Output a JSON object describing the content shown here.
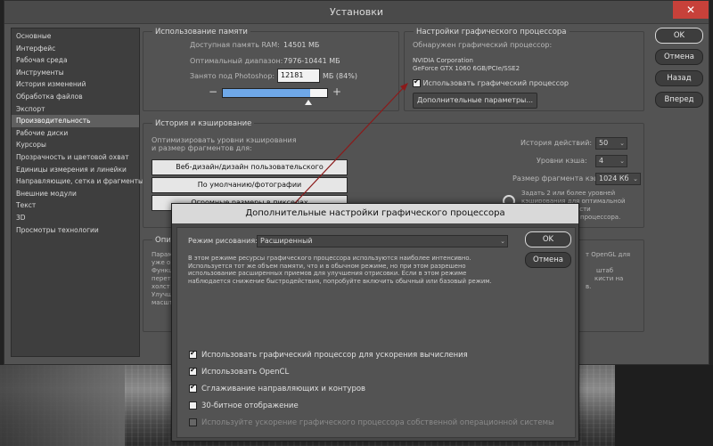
{
  "window": {
    "title": "Установки",
    "close_icon": "✕"
  },
  "sidebar": {
    "items": [
      {
        "label": "Основные"
      },
      {
        "label": "Интерфейс"
      },
      {
        "label": "Рабочая среда"
      },
      {
        "label": "Инструменты"
      },
      {
        "label": "История изменений"
      },
      {
        "label": "Обработка файлов"
      },
      {
        "label": "Экспорт"
      },
      {
        "label": "Производительность",
        "active": true
      },
      {
        "label": "Рабочие диски"
      },
      {
        "label": "Курсоры"
      },
      {
        "label": "Прозрачность и цветовой охват"
      },
      {
        "label": "Единицы измерения и линейки"
      },
      {
        "label": "Направляющие, сетка и фрагменты"
      },
      {
        "label": "Внешние модули"
      },
      {
        "label": "Текст"
      },
      {
        "label": "3D"
      },
      {
        "label": "Просмотры технологии"
      }
    ]
  },
  "memory": {
    "title": "Использование памяти",
    "available_label": "Доступная память RAM:",
    "available_value": "14501 МБ",
    "optimal_label": "Оптимальный диапазон:",
    "optimal_value": "7976-10441 МБ",
    "used_label": "Занято под Photoshop:",
    "used_value": "12181",
    "used_unit": "МБ (84%)",
    "used_fraction": 0.84,
    "minus": "−",
    "plus": "+"
  },
  "gpu": {
    "title": "Настройки графического процессора",
    "detected_label": "Обнаружен графический процессор:",
    "vendor": "NVIDIA Corporation",
    "model": "GeForce GTX 1060 6GB/PCIe/SSE2",
    "use_gpu_label": "Использовать графический процессор",
    "use_gpu_checked": true,
    "advanced_button": "Дополнительные параметры..."
  },
  "buttons": {
    "ok": "OK",
    "cancel": "Отмена",
    "back": "Назад",
    "forward": "Вперед"
  },
  "history_cache": {
    "title": "История и кэширование",
    "optimize_label_1": "Оптимизировать уровни кэширования",
    "optimize_label_2": "и размер фрагментов для:",
    "btn_web": "Веб-дизайн/дизайн пользовательского интерфейса",
    "btn_default": "По умолчанию/фотографии",
    "btn_huge": "Огромные размеры в пикселах",
    "history_states_label": "История действий:",
    "history_states_value": "50",
    "cache_levels_label": "Уровни кэша:",
    "cache_levels_value": "4",
    "tile_size_label": "Размер фрагмента кэша:",
    "tile_size_value": "1024 Кб",
    "hint_1": "Задать 2 или более уровней",
    "hint_2": "кэширования для оптимальной",
    "hint_3": "производительности",
    "hint_4": "процессора."
  },
  "options_group": {
    "title": "Опи",
    "left_fragments": [
      "Парам",
      "уже о",
      "Функц",
      "перета",
      "холст",
      "Улучш",
      "масшт"
    ],
    "right_fragments": [
      "т OpenGL для",
      "",
      "штаб",
      "кисти на",
      "в."
    ]
  },
  "dialog": {
    "title": "Дополнительные настройки графического процессора",
    "mode_label": "Режим рисования:",
    "mode_value": "Расширенный",
    "ok": "OK",
    "cancel": "Отмена",
    "description": [
      "В этом режиме ресурсы графического процессора используются наиболее интенсивно.",
      "Используется тот же объем памяти, что и в обычном режиме, но при этом разрешено",
      "использование расширенных приемов для улучшения отрисовки.  Если в этом режиме",
      "наблюдается снижение быстродействия, попробуйте включить обычный или базовый режим."
    ],
    "options": [
      {
        "label": "Использовать графический процессор для ускорения вычисления",
        "checked": true,
        "disabled": false
      },
      {
        "label": "Использовать OpenCL",
        "checked": true,
        "disabled": false
      },
      {
        "label": "Сглаживание направляющих и контуров",
        "checked": true,
        "disabled": false
      },
      {
        "label": "30-битное отображение",
        "checked": false,
        "disabled": false
      },
      {
        "label": "Используйте ускорение графического процессора собственной операционной системы",
        "checked": false,
        "disabled": true
      }
    ]
  },
  "colors": {
    "arrow": "#8b1a1a",
    "slider_fill": "#6fa8e8"
  }
}
